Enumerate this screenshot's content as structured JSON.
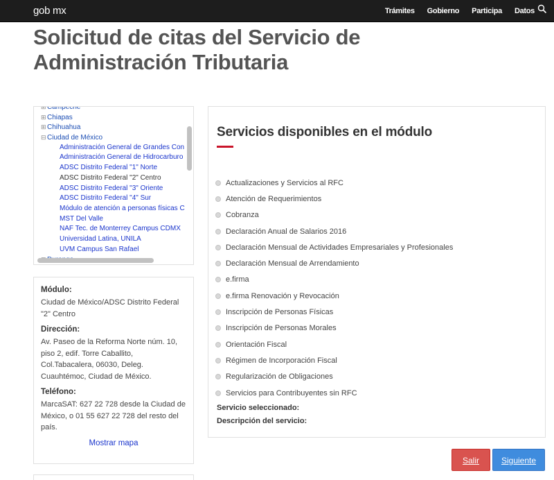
{
  "header": {
    "brand": "gob mx",
    "nav": [
      "Trámites",
      "Gobierno",
      "Participa",
      "Datos"
    ],
    "search_icon": "search-icon"
  },
  "page": {
    "title": "Solicitud de citas del Servicio de Administración Tributaria"
  },
  "tree": {
    "rows": [
      {
        "kind": "state",
        "expander": "⊞",
        "label": "Campeche"
      },
      {
        "kind": "state",
        "expander": "⊞",
        "label": "Chiapas"
      },
      {
        "kind": "state",
        "expander": "⊞",
        "label": "Chihuahua"
      },
      {
        "kind": "state",
        "expander": "⊟",
        "label": "Ciudad de México"
      },
      {
        "kind": "muni",
        "label": "Administración General de Grandes Con"
      },
      {
        "kind": "muni",
        "label": "Administración General de Hidrocarburo"
      },
      {
        "kind": "muni",
        "label": "ADSC Distrito Federal \"1\" Norte"
      },
      {
        "kind": "muni",
        "label": "ADSC Distrito Federal \"2\" Centro",
        "selected": true
      },
      {
        "kind": "muni",
        "label": "ADSC Distrito Federal \"3\" Oriente"
      },
      {
        "kind": "muni",
        "label": "ADSC Distrito Federal \"4\" Sur"
      },
      {
        "kind": "muni",
        "label": "Módulo de atención a personas físicas C"
      },
      {
        "kind": "muni",
        "label": "MST Del Valle"
      },
      {
        "kind": "muni",
        "label": "NAF Tec. de Monterrey Campus CDMX"
      },
      {
        "kind": "muni",
        "label": "Universidad Latina, UNILA"
      },
      {
        "kind": "muni",
        "label": "UVM Campus San Rafael"
      },
      {
        "kind": "state",
        "expander": "⊞",
        "label": "Durango"
      }
    ]
  },
  "info": {
    "modulo_label": "Módulo:",
    "modulo_value": "Ciudad de México/ADSC Distrito Federal \"2\" Centro",
    "direccion_label": "Dirección:",
    "direccion_value": "Av. Paseo de la Reforma Norte núm. 10, piso 2, edif. Torre Caballito, Col.Tabacalera, 06030, Deleg. Cuauhtémoc, Ciudad de México.",
    "telefono_label": "Teléfono:",
    "telefono_value": "MarcaSAT: 627 22 728 desde la Ciudad de México, o 01 55 627 22 728 del resto del país.",
    "map_link": "Mostrar mapa"
  },
  "services": {
    "title": "Servicios disponibles en el módulo",
    "items": [
      "Actualizaciones y Servicios al RFC",
      "Atención de Requerimientos",
      "Cobranza",
      "Declaración Anual de Salarios 2016",
      "Declaración Mensual de Actividades Empresariales y Profesionales",
      "Declaración Mensual de Arrendamiento",
      "e.firma",
      "e.firma Renovación y Revocación",
      "Inscripción de Personas Físicas",
      "Inscripción de Personas Morales",
      "Orientación Fiscal",
      "Régimen de Incorporación Fiscal",
      "Regularización de Obligaciones",
      "Servicios para Contribuyentes sin RFC"
    ],
    "selected_label": "Servicio seleccionado:",
    "description_label": "Descripción del servicio:"
  },
  "buttons": {
    "salir": "Salir",
    "siguiente": "Siguiente"
  },
  "colors": {
    "topbar": "#1d1d1d",
    "accent_red": "#c9142a",
    "link_blue": "#1a35cc",
    "btn_red": "#d9534f",
    "btn_blue": "#3f8cde"
  }
}
